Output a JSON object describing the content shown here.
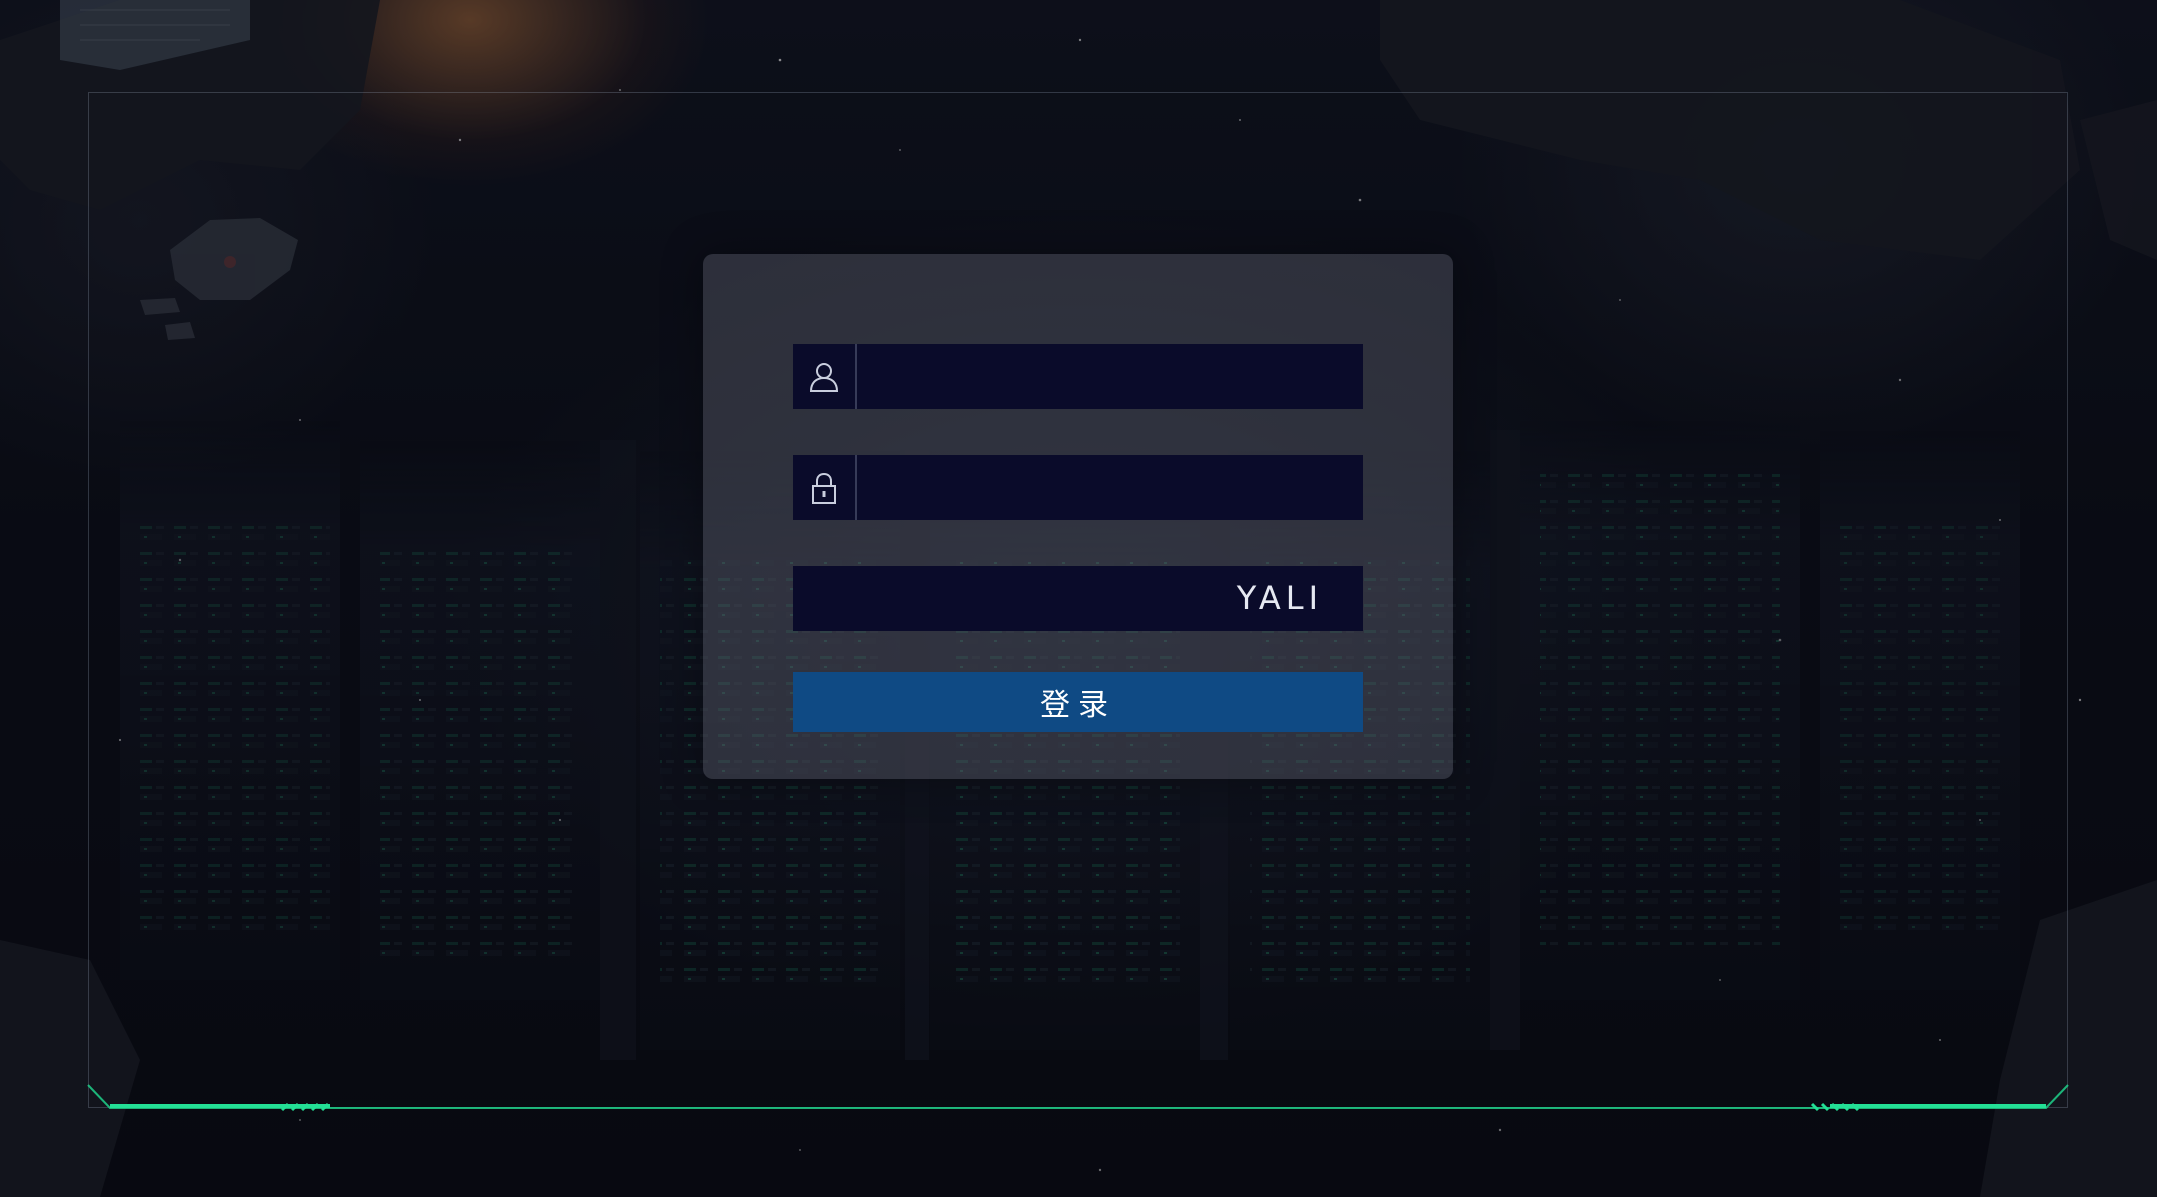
{
  "login": {
    "username": {
      "icon": "user-icon",
      "value": "",
      "placeholder": ""
    },
    "password": {
      "icon": "lock-icon",
      "value": "",
      "placeholder": ""
    },
    "captcha": {
      "value": "",
      "placeholder": "",
      "code": "YALI"
    },
    "submit_label": "登录"
  },
  "colors": {
    "panel": "#5c606e",
    "field_bg": "#0a0b2a",
    "button_bg": "#0f4a84",
    "frame_accent": "#1fd08a"
  }
}
